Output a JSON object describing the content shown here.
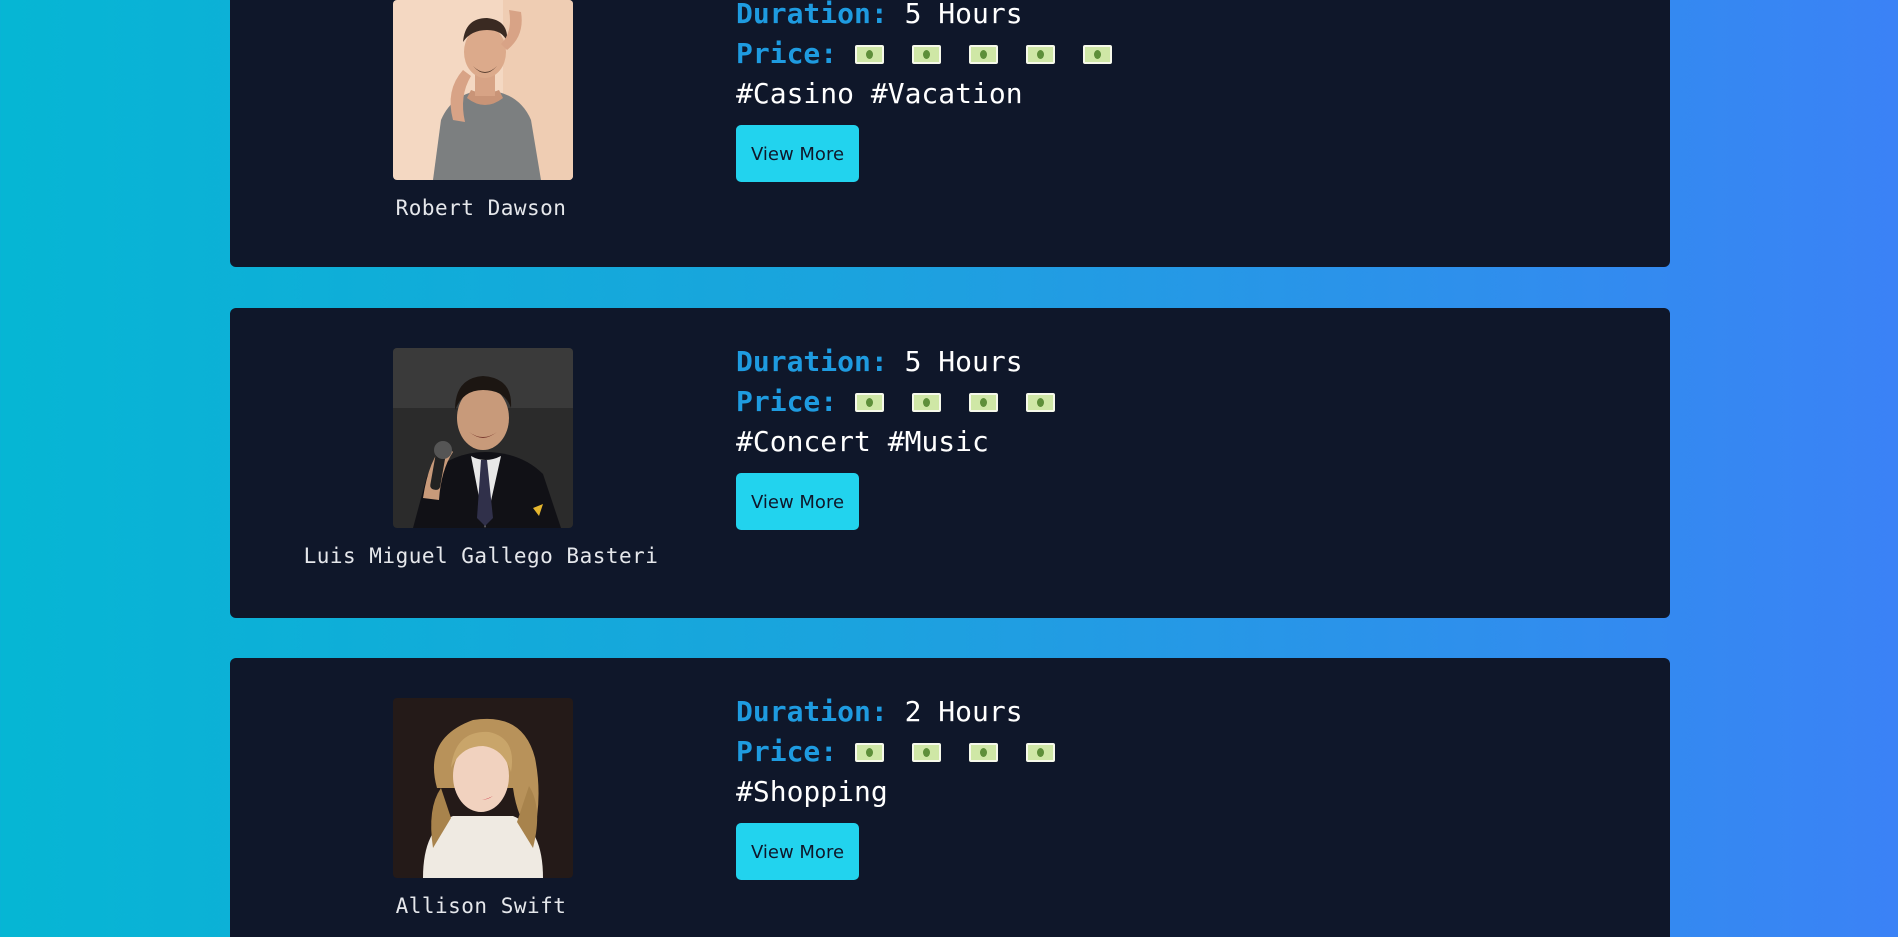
{
  "labels": {
    "duration": "Duration:",
    "price": "Price:",
    "button": "View More"
  },
  "money_icon": "dollar-banknote-icon",
  "colors": {
    "card_bg": "#0f172a",
    "label": "#1e9be0",
    "button_bg": "#22d3ee",
    "page_gradient_start": "#06b6d4",
    "page_gradient_end": "#3b82f6"
  },
  "cards": [
    {
      "name": "Robert Dawson",
      "photo": "man-in-gray-tshirt-portrait",
      "duration": "5 Hours",
      "price_level": 5,
      "tags": "#Casino #Vacation"
    },
    {
      "name": "Luis Miguel Gallego Basteri",
      "photo": "singer-with-microphone-portrait",
      "duration": "5 Hours",
      "price_level": 4,
      "tags": "#Concert #Music"
    },
    {
      "name": "Allison Swift",
      "photo": "blonde-woman-portrait",
      "duration": "2 Hours",
      "price_level": 4,
      "tags": "#Shopping"
    }
  ]
}
